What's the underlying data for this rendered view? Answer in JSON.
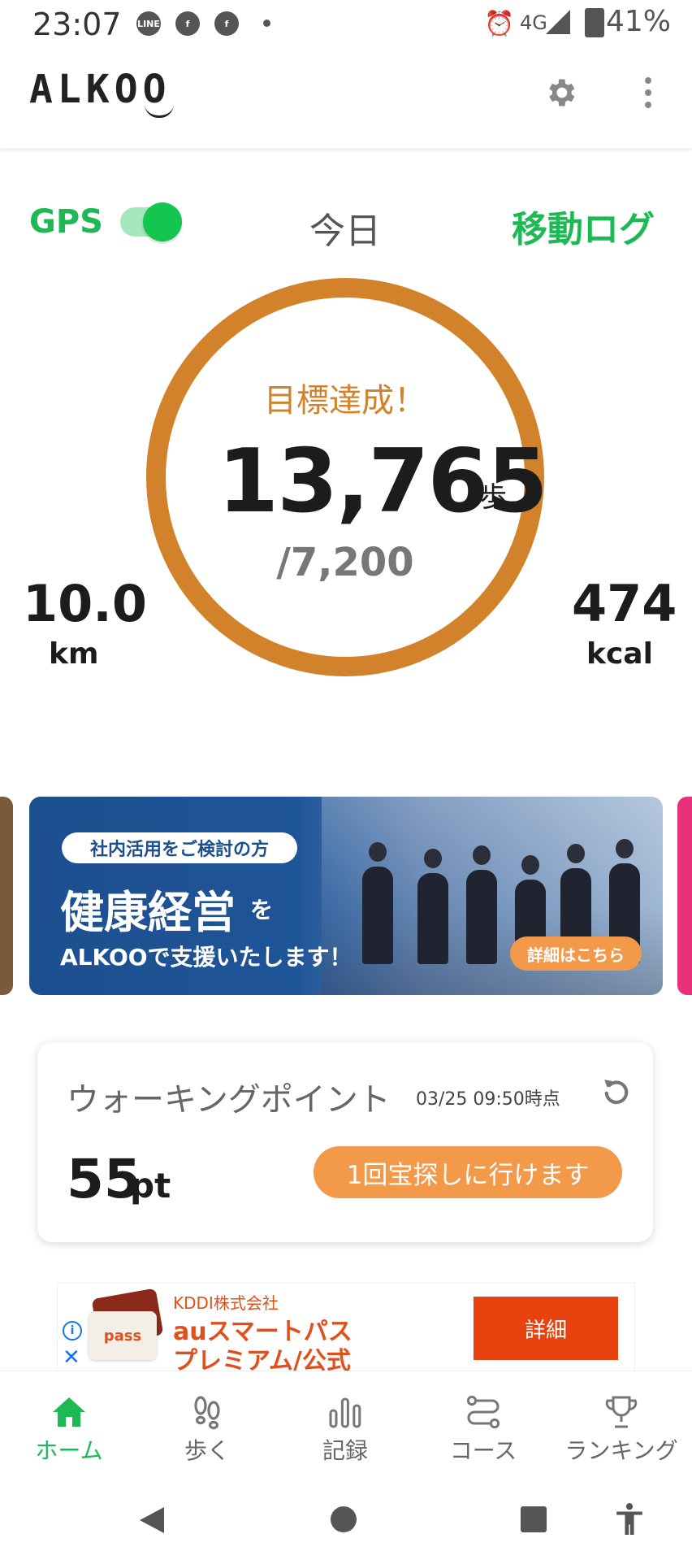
{
  "status_bar": {
    "time": "23:07",
    "notification_icons": [
      "line-icon",
      "facebook-icon",
      "facebook-icon"
    ],
    "network": "4G",
    "battery": "41%"
  },
  "header": {
    "logo": "ALKOO",
    "settings_icon": "gear-icon",
    "more_icon": "more-vert-icon"
  },
  "today": {
    "gps_label": "GPS",
    "gps_enabled": true,
    "day_label": "今日",
    "log_link": "移動ログ",
    "goal_message": "目標達成！",
    "steps": "13,765",
    "steps_unit": "歩",
    "steps_goal": "/7,200",
    "goal_progress": 1.0,
    "distance": "10.0",
    "distance_unit": "km",
    "calories": "474",
    "calories_unit": "kcal",
    "ring_color": "#d2822a"
  },
  "banner": {
    "pill": "社内活用をご検討の方",
    "headline": "健康経営",
    "headline_suffix": "を",
    "subline": "ALKOOで支援いたします！",
    "cta": "詳細はこちら"
  },
  "walking_point": {
    "title": "ウォーキングポイント",
    "timestamp": "03/25 09:50時点",
    "points": "55",
    "points_unit": "pt",
    "action": "1回宝探しに行けます"
  },
  "ad": {
    "advertiser": "KDDI株式会社",
    "logo_text": "pass",
    "title_line1": "auスマートパス",
    "title_line2": "プレミアム/公式",
    "button": "詳細"
  },
  "bottom_nav": [
    {
      "label": "ホーム",
      "icon": "home-icon",
      "active": true
    },
    {
      "label": "歩く",
      "icon": "footprints-icon",
      "active": false
    },
    {
      "label": "記録",
      "icon": "bar-chart-icon",
      "active": false
    },
    {
      "label": "コース",
      "icon": "route-icon",
      "active": false
    },
    {
      "label": "ランキング",
      "icon": "trophy-icon",
      "active": false
    }
  ],
  "colors": {
    "brand_green": "#1db954",
    "accent_orange": "#f2994a",
    "ring_orange": "#d2822a"
  }
}
